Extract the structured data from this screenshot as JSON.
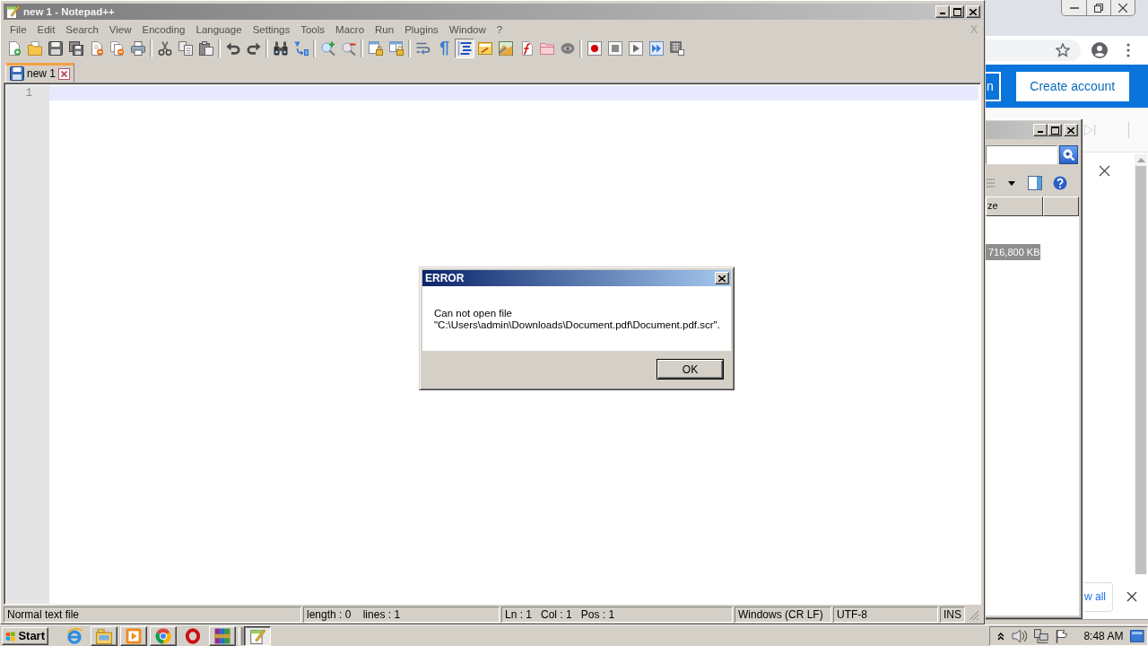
{
  "browser_window": {
    "header_buttons": [
      {
        "label": "n",
        "kind": "outline"
      },
      {
        "label": "Create account",
        "kind": "filled"
      }
    ],
    "footer_button": "w all"
  },
  "explorer_window": {
    "column_header": "ze",
    "rows": [
      {
        "size": "716,800 KB",
        "selected": true
      }
    ]
  },
  "notepad": {
    "title": "new 1 - Notepad++",
    "menu": [
      "File",
      "Edit",
      "Search",
      "View",
      "Encoding",
      "Language",
      "Settings",
      "Tools",
      "Macro",
      "Run",
      "Plugins",
      "Window",
      "?"
    ],
    "close_document": "X",
    "toolbar_groups": [
      [
        {
          "kind": "new",
          "on": false
        },
        {
          "kind": "open",
          "on": false
        },
        {
          "kind": "save",
          "on": false
        },
        {
          "kind": "save_all",
          "on": false
        },
        {
          "kind": "close",
          "on": false
        },
        {
          "kind": "close_all",
          "on": false
        },
        {
          "kind": "print",
          "on": false
        }
      ],
      [
        {
          "kind": "cut",
          "on": false
        },
        {
          "kind": "copy",
          "on": false
        },
        {
          "kind": "paste",
          "on": false
        }
      ],
      [
        {
          "kind": "undo",
          "on": false
        },
        {
          "kind": "redo",
          "on": false
        }
      ],
      [
        {
          "kind": "find",
          "on": false
        },
        {
          "kind": "replace",
          "on": false
        }
      ],
      [
        {
          "kind": "zoom_in",
          "on": false
        },
        {
          "kind": "zoom_out",
          "on": false
        }
      ],
      [
        {
          "kind": "sync_v",
          "on": false
        },
        {
          "kind": "sync_h",
          "on": false
        }
      ],
      [
        {
          "kind": "wrap",
          "on": false
        },
        {
          "kind": "all_chars",
          "on": false
        },
        {
          "kind": "indent_guide",
          "on": true
        },
        {
          "kind": "language",
          "on": false
        },
        {
          "kind": "doc_map",
          "on": false
        },
        {
          "kind": "func_list",
          "on": false
        },
        {
          "kind": "folder",
          "on": false
        },
        {
          "kind": "monitor",
          "on": false
        }
      ],
      [
        {
          "kind": "record",
          "on": false
        },
        {
          "kind": "stop",
          "on": false
        },
        {
          "kind": "play",
          "on": false
        },
        {
          "kind": "play_multi",
          "on": false
        },
        {
          "kind": "save_macro",
          "on": false
        }
      ]
    ],
    "tabs": [
      {
        "label": "new 1",
        "selected": true
      }
    ],
    "line_numbers": [
      "1"
    ],
    "status_bar": [
      "Normal text file",
      "length : 0    lines : 1",
      "Ln : 1   Col : 1   Pos : 1",
      "Windows (CR LF)",
      "UTF-8",
      "INS"
    ]
  },
  "dialog": {
    "title": "ERROR",
    "message": "Can not open file\n\"C:\\Users\\admin\\Downloads\\Document.pdf\\Document.pdf.scr\".",
    "button": "OK"
  },
  "taskbar": {
    "start": "Start",
    "quick_launch": [
      {
        "kind": "ie",
        "raised": false
      },
      {
        "kind": "explorer",
        "raised": true
      },
      {
        "kind": "media",
        "raised": true
      },
      {
        "kind": "chrome",
        "raised": true
      },
      {
        "kind": "opera",
        "raised": false
      },
      {
        "kind": "archive",
        "raised": true
      }
    ],
    "tasks": [
      {
        "kind": "notepad",
        "selected": true
      }
    ],
    "clock": "8:48 AM"
  }
}
